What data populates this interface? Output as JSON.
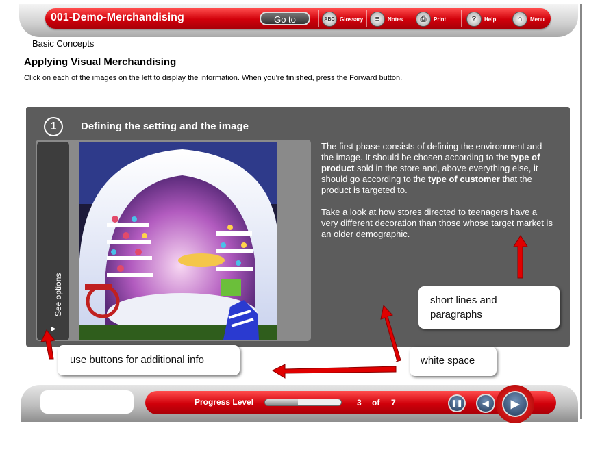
{
  "header": {
    "course_title": "001-Demo-Merchandising",
    "goto_label": "Go to",
    "tools": [
      {
        "label": "Glossary",
        "icon": "glossary-icon",
        "glyph": "ABC"
      },
      {
        "label": "Notes",
        "icon": "notes-icon",
        "glyph": "≡"
      },
      {
        "label": "Print",
        "icon": "print-icon",
        "glyph": "⎙"
      },
      {
        "label": "Help",
        "icon": "help-icon",
        "glyph": "?"
      },
      {
        "label": "Menu",
        "icon": "menu-icon",
        "glyph": "⌂"
      }
    ]
  },
  "breadcrumb": "Basic Concepts",
  "page_title": "Applying Visual Merchandising",
  "instructions": "Click on each of the images on the left to display the information. When you’re finished, press the Forward button.",
  "panel": {
    "step_number": "1",
    "heading": "Defining the setting and the image",
    "side_tab_label": "See options",
    "paragraph1": {
      "t1": "The first phase consists of defining the environment and the image. It should be chosen according to the ",
      "b1": "type of product",
      "t2": " sold in the store and, above everything else, it should go according to the ",
      "b2": "type of customer",
      "t3": " that the product is targeted to."
    },
    "paragraph2": "Take a look at how stores directed to teenagers have a very different decoration than those whose target market is an older demographic."
  },
  "callouts": {
    "short_lines": "short lines and paragraphs",
    "white_space": "white space",
    "use_buttons": "use buttons for additional info"
  },
  "footer": {
    "progress_label": "Progress Level",
    "progress_fraction": 0.43,
    "page_current": "3",
    "page_of": "of",
    "page_total": "7"
  },
  "colors": {
    "accent_red": "#d0000a",
    "panel_gray": "#5c5c5c",
    "arrow_red": "#e00000"
  }
}
